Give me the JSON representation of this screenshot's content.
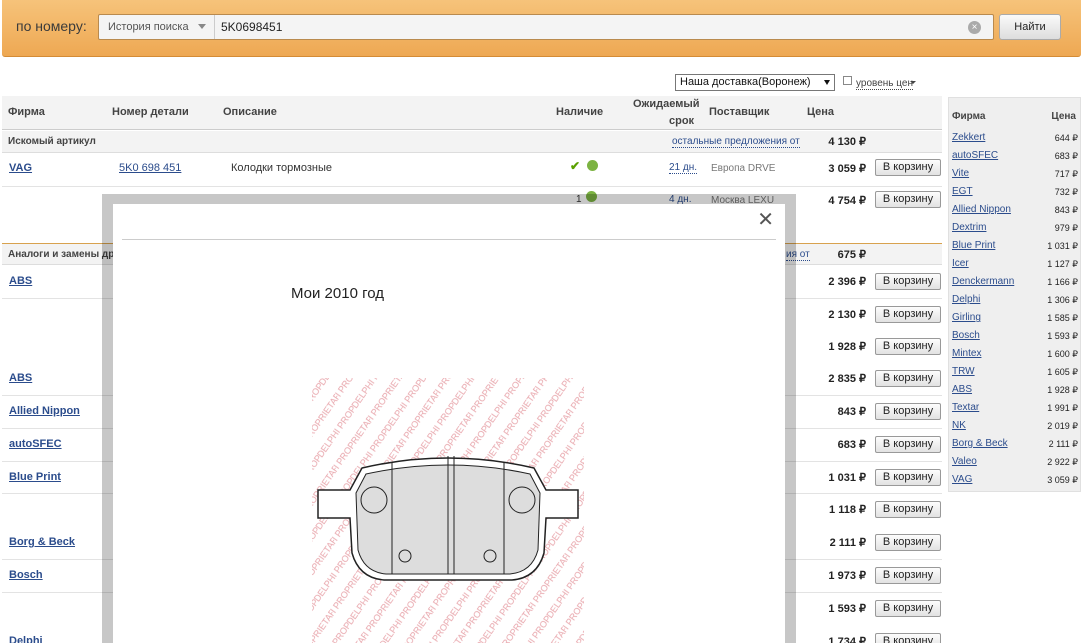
{
  "search": {
    "label": "по номеру:",
    "history_label": "История поиска",
    "query": "5K0698451",
    "find_button": "Найти"
  },
  "filters": {
    "delivery_selected": "Наша доставка(Воронеж)",
    "price_level_label": "уровень цен"
  },
  "table": {
    "headers": {
      "firm": "Фирма",
      "part_number": "Номер детали",
      "description": "Описание",
      "availability": "Наличие",
      "expected_line1": "Ожидаемый",
      "expected_line2": "срок",
      "supplier": "Поставщик",
      "price": "Цена"
    },
    "searched_section": "Искомый артикул",
    "searched_others": "остальные предложения от",
    "searched_others_price": "4 130 ₽",
    "searched_rows": [
      {
        "brand": "VAG",
        "part": "5K0 698 451",
        "description": "Колодки тормозные",
        "days": "21 дн.",
        "supplier": "Европа DRVE",
        "price": "3 059 ₽",
        "cart": "В корзину"
      },
      {
        "qty": "1",
        "days": "4 дн.",
        "supplier": "Москва LEXU",
        "price": "4 754 ₽",
        "cart": "В корзину"
      }
    ],
    "analogs_section": "Аналоги и замены др",
    "analogs_others": "ия от",
    "analogs_others_price": "675 ₽",
    "analog_rows": [
      {
        "brand": "ABS",
        "price": "2 396 ₽",
        "cart": "В корзину"
      },
      {
        "brand": "",
        "price": "2 130 ₽",
        "cart": "В корзину"
      },
      {
        "brand": "",
        "price": "1 928 ₽",
        "cart": "В корзину"
      },
      {
        "brand": "ABS",
        "price": "2 835 ₽",
        "cart": "В корзину"
      },
      {
        "brand": "Allied Nippon",
        "price": "843 ₽",
        "cart": "В корзину"
      },
      {
        "brand": "autoSFEC",
        "price": "683 ₽",
        "cart": "В корзину"
      },
      {
        "brand": "Blue Print",
        "price": "1 031 ₽",
        "cart": "В корзину"
      },
      {
        "brand": "",
        "price": "1 118 ₽",
        "cart": "В корзину"
      },
      {
        "brand": "Borg & Beck",
        "price": "2 111 ₽",
        "cart": "В корзину"
      },
      {
        "brand": "Bosch",
        "price": "1 973 ₽",
        "cart": "В корзину"
      },
      {
        "brand": "",
        "price": "1 593 ₽",
        "cart": "В корзину"
      },
      {
        "brand": "Delphi",
        "price": "1 734 ₽",
        "cart": "В корзину"
      }
    ]
  },
  "modal": {
    "caption": "Мои 2010 год",
    "watermark": "DELPHI PROPRIETARY"
  },
  "side_panel": {
    "header_firm": "Фирма",
    "header_price": "Цена",
    "rows": [
      {
        "brand": "Zekkert",
        "price": "644 ₽"
      },
      {
        "brand": "autoSFEC",
        "price": "683 ₽"
      },
      {
        "brand": "Vite",
        "price": "717 ₽"
      },
      {
        "brand": "EGT",
        "price": "732 ₽"
      },
      {
        "brand": "Allied Nippon",
        "price": "843 ₽"
      },
      {
        "brand": "Dextrim",
        "price": "979 ₽"
      },
      {
        "brand": "Blue Print",
        "price": "1 031 ₽"
      },
      {
        "brand": "Icer",
        "price": "1 127 ₽"
      },
      {
        "brand": "Denckermann",
        "price": "1 166 ₽"
      },
      {
        "brand": "Delphi",
        "price": "1 306 ₽"
      },
      {
        "brand": "Girling",
        "price": "1 585 ₽"
      },
      {
        "brand": "Bosch",
        "price": "1 593 ₽"
      },
      {
        "brand": "Mintex",
        "price": "1 600 ₽"
      },
      {
        "brand": "TRW",
        "price": "1 605 ₽"
      },
      {
        "brand": "ABS",
        "price": "1 928 ₽"
      },
      {
        "brand": "Textar",
        "price": "1 991 ₽"
      },
      {
        "brand": "NK",
        "price": "2 019 ₽"
      },
      {
        "brand": "Borg & Beck",
        "price": "2 111 ₽"
      },
      {
        "brand": "Valeo",
        "price": "2 922 ₽"
      },
      {
        "brand": "VAG",
        "price": "3 059 ₽"
      }
    ]
  }
}
